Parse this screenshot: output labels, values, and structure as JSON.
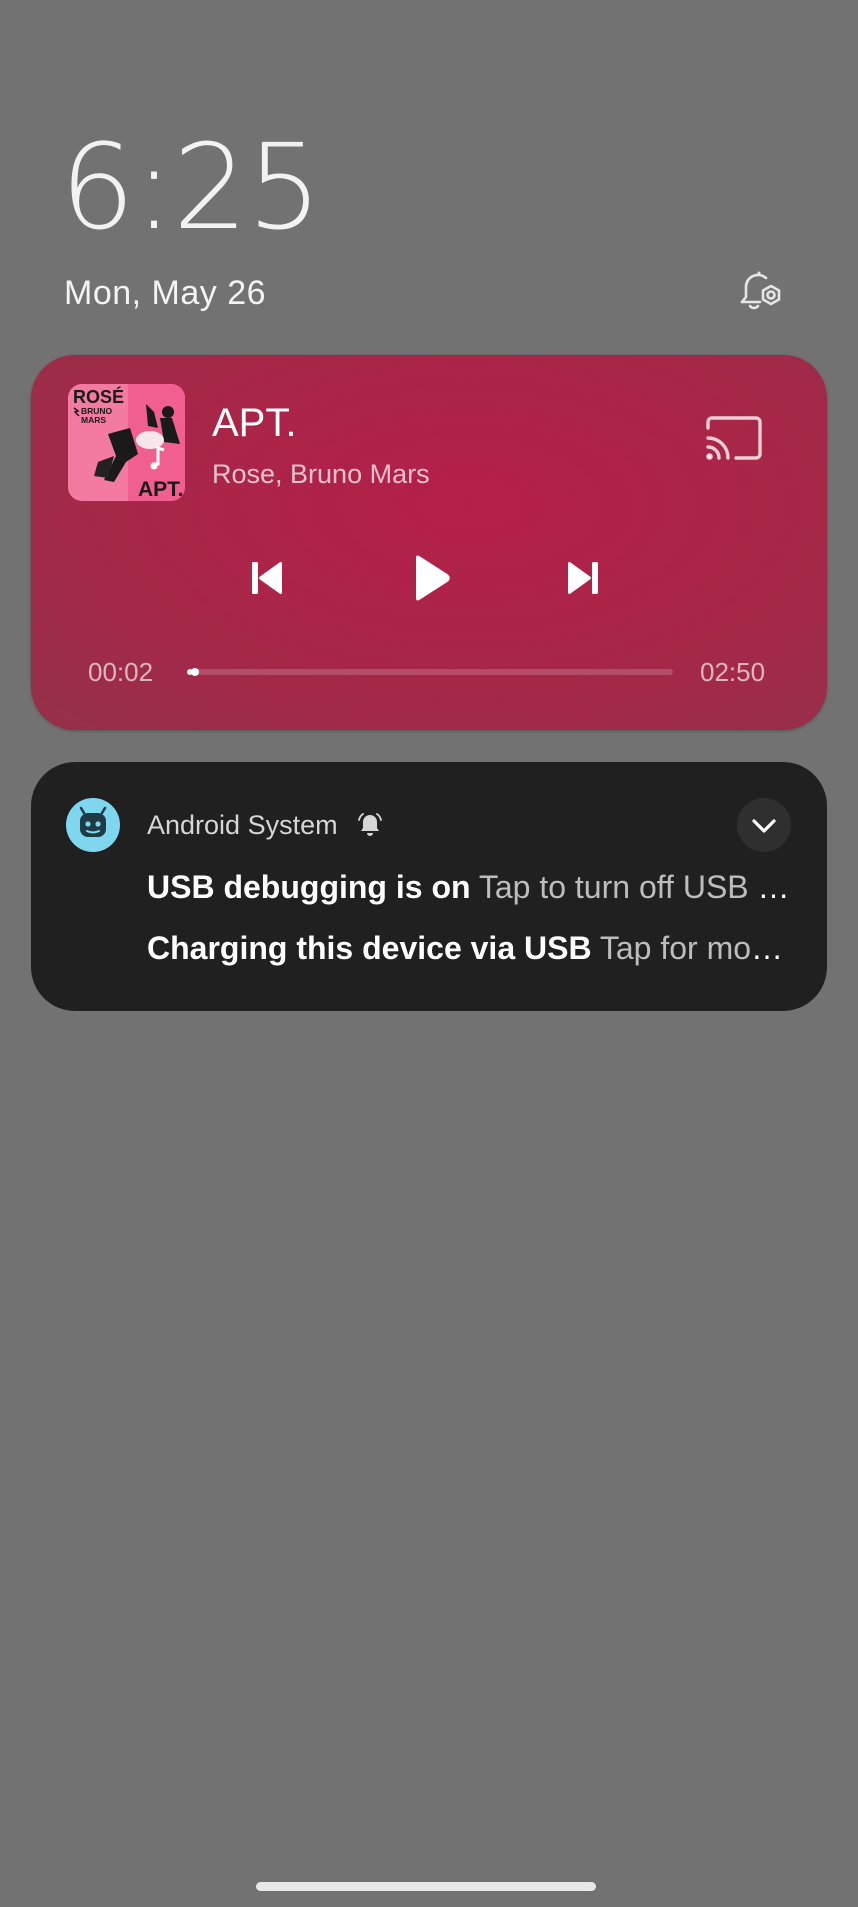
{
  "lockscreen": {
    "time": "6:25",
    "date": "Mon, May 26"
  },
  "media": {
    "title": "APT.",
    "artist": "Rose, Bruno Mars",
    "elapsed": "00:02",
    "duration": "02:50",
    "progress_fraction": 0.012,
    "accent_color": "#b51f48",
    "album_art": {
      "artist_text": "ROSÉ",
      "feat_text_1": "BRUNO",
      "feat_text_2": "MARS",
      "album_text": "APT."
    },
    "icons": {
      "cast": "cast-icon",
      "previous": "skip-previous-icon",
      "play": "play-icon",
      "next": "skip-next-icon"
    }
  },
  "system_notification": {
    "app_name": "Android System",
    "app_icon": "android-system-icon",
    "app_icon_color": "#7fd7ef",
    "items": [
      {
        "title": "USB debugging is on",
        "body": "Tap to turn off USB debugging"
      },
      {
        "title": "Charging this device via USB",
        "body": "Tap for more options."
      }
    ]
  },
  "icons": {
    "notification_settings": "notification-settings-icon",
    "bell": "bell-icon",
    "expand": "chevron-down-icon"
  }
}
